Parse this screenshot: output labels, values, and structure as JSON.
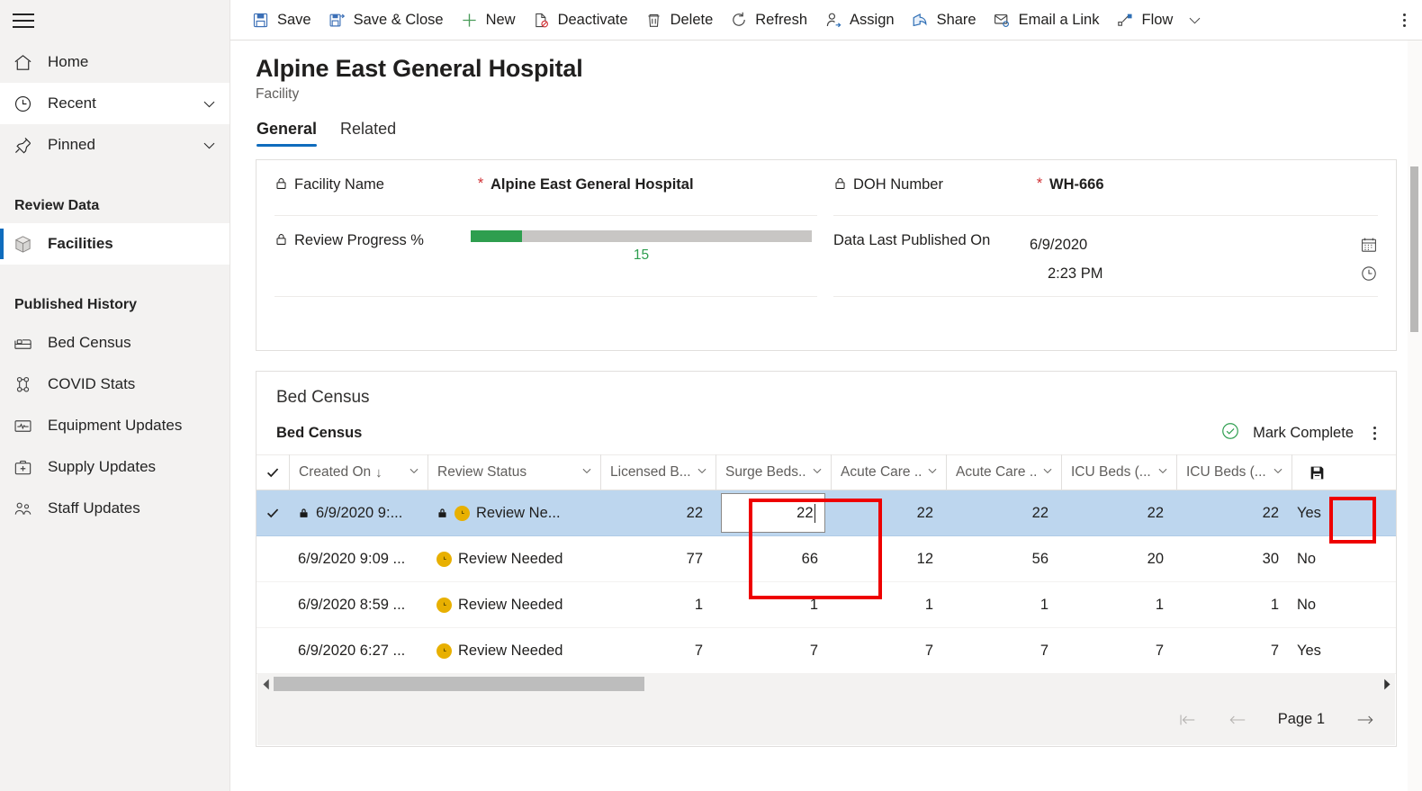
{
  "sidebar": {
    "hamburger_label": "Site Map",
    "items": [
      {
        "label": "Home",
        "icon": "home-icon",
        "chevron": false,
        "state": "default"
      },
      {
        "label": "Recent",
        "icon": "clock-icon",
        "chevron": true,
        "state": "white"
      },
      {
        "label": "Pinned",
        "icon": "pin-icon",
        "chevron": true,
        "state": "default"
      }
    ],
    "groups": [
      {
        "title": "Review Data",
        "items": [
          {
            "label": "Facilities",
            "icon": "cube-icon",
            "selected": true
          }
        ]
      },
      {
        "title": "Published History",
        "items": [
          {
            "label": "Bed Census",
            "icon": "bed-icon",
            "selected": false
          },
          {
            "label": "COVID Stats",
            "icon": "virus-icon",
            "selected": false
          },
          {
            "label": "Equipment Updates",
            "icon": "monitor-icon",
            "selected": false
          },
          {
            "label": "Supply Updates",
            "icon": "medkit-icon",
            "selected": false
          },
          {
            "label": "Staff Updates",
            "icon": "people-icon",
            "selected": false
          }
        ]
      }
    ]
  },
  "commandbar": {
    "items": [
      {
        "label": "Save",
        "icon": "save-icon"
      },
      {
        "label": "Save & Close",
        "icon": "save-close-icon"
      },
      {
        "label": "New",
        "icon": "plus-icon"
      },
      {
        "label": "Deactivate",
        "icon": "deactivate-icon"
      },
      {
        "label": "Delete",
        "icon": "trash-icon"
      },
      {
        "label": "Refresh",
        "icon": "refresh-icon"
      },
      {
        "label": "Assign",
        "icon": "assign-person-icon"
      },
      {
        "label": "Share",
        "icon": "share-icon"
      },
      {
        "label": "Email a Link",
        "icon": "email-link-icon"
      },
      {
        "label": "Flow",
        "icon": "flow-icon",
        "chevron": true
      }
    ],
    "overflow_label": "More commands"
  },
  "record": {
    "title": "Alpine East General Hospital",
    "subtitle": "Facility",
    "tabs": [
      {
        "label": "General",
        "active": true
      },
      {
        "label": "Related",
        "active": false
      }
    ]
  },
  "general_form": {
    "left": [
      {
        "label": "Facility Name",
        "locked": true,
        "required": true,
        "value": "Alpine East General Hospital",
        "type": "text"
      },
      {
        "label": "Review Progress %",
        "locked": true,
        "required": false,
        "value": "15",
        "progress_percent": 15,
        "type": "progress",
        "progress_color": "#2e9e4f"
      }
    ],
    "right": [
      {
        "label": "DOH Number",
        "locked": true,
        "required": true,
        "value": "WH-666",
        "type": "text"
      },
      {
        "label": "Data Last Published On",
        "locked": false,
        "required": false,
        "date_value": "6/9/2020",
        "time_value": "2:23 PM",
        "type": "datetime",
        "date_icon": "calendar-icon",
        "time_icon": "clock-icon"
      }
    ]
  },
  "bed_census": {
    "section_title": "Bed Census",
    "grid_title": "Bed Census",
    "mark_complete_label": "Mark Complete",
    "mark_complete_icon": "check-circle-icon",
    "more_commands_label": "More commands",
    "columns": [
      {
        "key": "check",
        "label": "",
        "type": "check"
      },
      {
        "key": "created_on",
        "label": "Created On",
        "sorted": true,
        "sort_dir": "↓",
        "chevron": true,
        "type": "text"
      },
      {
        "key": "review_status",
        "label": "Review Status",
        "chevron": true,
        "type": "text"
      },
      {
        "key": "licensed_beds",
        "label": "Licensed B...",
        "chevron": true,
        "type": "num"
      },
      {
        "key": "surge_beds",
        "label": "Surge Beds...",
        "chevron": true,
        "type": "num",
        "highlighted": true
      },
      {
        "key": "acute_care_1",
        "label": "Acute Care ...",
        "chevron": true,
        "type": "num"
      },
      {
        "key": "acute_care_2",
        "label": "Acute Care ...",
        "chevron": true,
        "type": "num"
      },
      {
        "key": "icu_beds_1",
        "label": "ICU Beds (...",
        "chevron": true,
        "type": "num"
      },
      {
        "key": "icu_beds_2",
        "label": "ICU Beds (...",
        "chevron": true,
        "type": "num"
      },
      {
        "key": "save_col",
        "label": "",
        "type": "saveicon",
        "icon": "save-icon",
        "highlighted": true
      }
    ],
    "rows": [
      {
        "selected": true,
        "checked": true,
        "created_on": "6/9/2020 9:...",
        "created_on_locked": true,
        "review_status": "Review Ne...",
        "review_status_locked": true,
        "review_status_badge": "clock-badge",
        "licensed_beds": "22",
        "surge_beds": "22",
        "surge_beds_editing": true,
        "acute_care_1": "22",
        "acute_care_2": "22",
        "icu_beds_1": "22",
        "icu_beds_2": "22",
        "last_col": "Yes"
      },
      {
        "selected": false,
        "checked": false,
        "created_on": "6/9/2020 9:09 ...",
        "created_on_locked": false,
        "review_status": "Review Needed",
        "review_status_locked": false,
        "review_status_badge": "clock-badge",
        "licensed_beds": "77",
        "surge_beds": "66",
        "surge_beds_editing": false,
        "acute_care_1": "12",
        "acute_care_2": "56",
        "icu_beds_1": "20",
        "icu_beds_2": "30",
        "last_col": "No"
      },
      {
        "selected": false,
        "checked": false,
        "created_on": "6/9/2020 8:59 ...",
        "created_on_locked": false,
        "review_status": "Review Needed",
        "review_status_locked": false,
        "review_status_badge": "clock-badge",
        "licensed_beds": "1",
        "surge_beds": "1",
        "surge_beds_editing": false,
        "acute_care_1": "1",
        "acute_care_2": "1",
        "icu_beds_1": "1",
        "icu_beds_2": "1",
        "last_col": "No"
      },
      {
        "selected": false,
        "checked": false,
        "created_on": "6/9/2020 6:27 ...",
        "created_on_locked": false,
        "review_status": "Review Needed",
        "review_status_locked": false,
        "review_status_badge": "clock-badge",
        "licensed_beds": "7",
        "surge_beds": "7",
        "surge_beds_editing": false,
        "acute_care_1": "7",
        "acute_care_2": "7",
        "icu_beds_1": "7",
        "icu_beds_2": "7",
        "last_col": "Yes"
      }
    ],
    "paging": {
      "first_label": "First page",
      "prev_label": "Previous page",
      "page_label": "Page 1",
      "next_label": "Next page"
    }
  },
  "colors": {
    "accent": "#0f6cbd",
    "selected_row": "#bdd6ee",
    "progress_green": "#2e9e4f",
    "required_red": "#d13438",
    "annotation_red": "#ee0000",
    "status_amber": "#e8b001"
  }
}
